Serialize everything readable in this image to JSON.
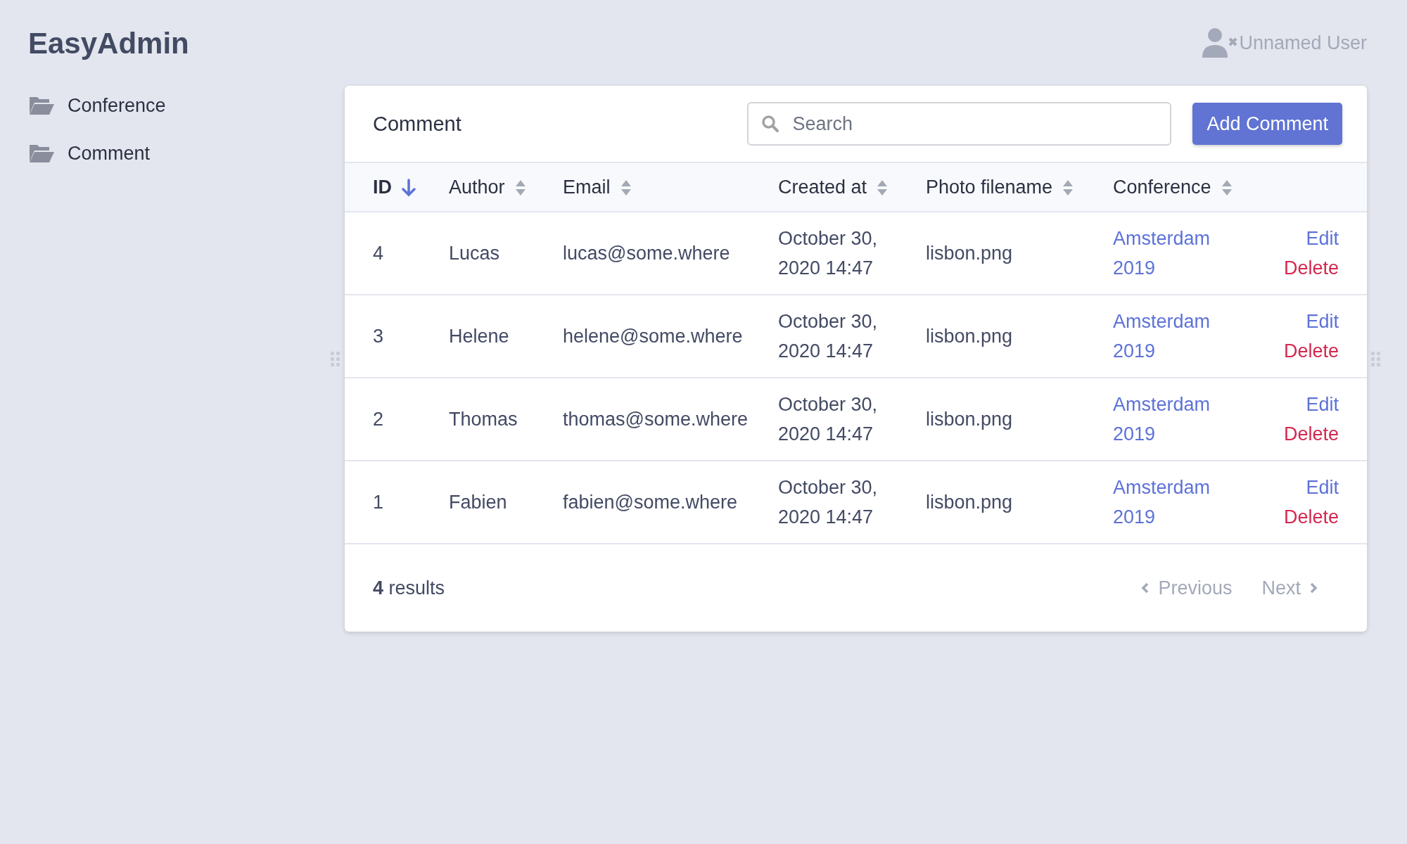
{
  "brand": "EasyAdmin",
  "sidebar": {
    "items": [
      {
        "label": "Conference",
        "selected": false
      },
      {
        "label": "Comment",
        "selected": false
      }
    ]
  },
  "user": {
    "name": "Unnamed User"
  },
  "card": {
    "title": "Comment",
    "search": {
      "placeholder": "Search"
    },
    "add_button": "Add Comment"
  },
  "table": {
    "columns": [
      {
        "label": "ID",
        "sorted": true
      },
      {
        "label": "Author",
        "sorted": false
      },
      {
        "label": "Email",
        "sorted": false
      },
      {
        "label": "Created at",
        "sorted": false
      },
      {
        "label": "Photo filename",
        "sorted": false
      },
      {
        "label": "Conference",
        "sorted": false
      }
    ],
    "rows": [
      {
        "id": "4",
        "author": "Lucas",
        "email": "lucas@some.where",
        "created_at": "October 30, 2020 14:47",
        "photo": "lisbon.png",
        "conference": "Amsterdam 2019",
        "actions": [
          "Edit",
          "Delete"
        ]
      },
      {
        "id": "3",
        "author": "Helene",
        "email": "helene@some.where",
        "created_at": "October 30, 2020 14:47",
        "photo": "lisbon.png",
        "conference": "Amsterdam 2019",
        "actions": [
          "Edit",
          "Delete"
        ]
      },
      {
        "id": "2",
        "author": "Thomas",
        "email": "thomas@some.where",
        "created_at": "October 30, 2020 14:47",
        "photo": "lisbon.png",
        "conference": "Amsterdam 2019",
        "actions": [
          "Edit",
          "Delete"
        ]
      },
      {
        "id": "1",
        "author": "Fabien",
        "email": "fabien@some.where",
        "created_at": "October 30, 2020 14:47",
        "photo": "lisbon.png",
        "conference": "Amsterdam 2019",
        "actions": [
          "Edit",
          "Delete"
        ]
      }
    ]
  },
  "footer": {
    "results": "**4** results",
    "previous": {
      "label": "Previous",
      "disabled": true
    },
    "next": {
      "label": "Next",
      "disabled": true
    }
  }
}
